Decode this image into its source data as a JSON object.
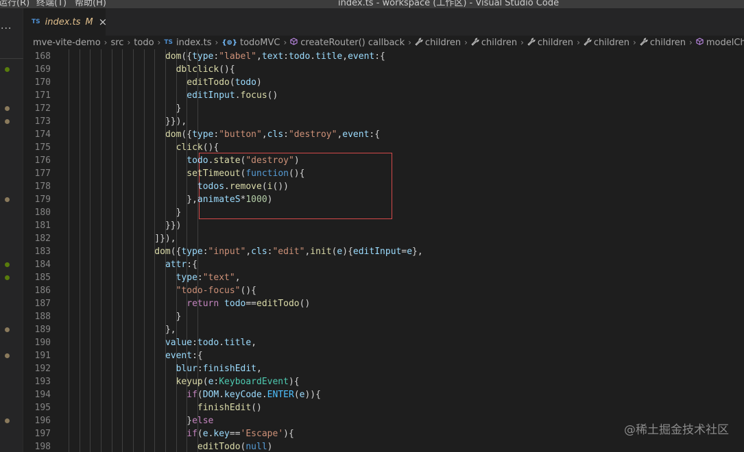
{
  "titlebar": {
    "menus": [
      "运行(R)",
      "终端(T)",
      "帮助(H)"
    ],
    "window_title": "index.ts - workspace (工作区) - Visual Studio Code"
  },
  "sidebar": {
    "more_label": "···"
  },
  "tab": {
    "lang": "TS",
    "name": "index.ts",
    "modified": "M",
    "close": "×"
  },
  "breadcrumb": {
    "items": [
      {
        "label": "mve-vite-demo",
        "icon": "none"
      },
      {
        "label": "src",
        "icon": "none"
      },
      {
        "label": "todo",
        "icon": "none"
      },
      {
        "label": "index.ts",
        "icon": "ts-file-icon",
        "badge": "TS"
      },
      {
        "label": "todoMVC",
        "icon": "namespace-icon",
        "badge": "{⊚}"
      },
      {
        "label": "createRouter() callback",
        "icon": "method-cube-icon"
      },
      {
        "label": "children",
        "icon": "wrench-icon"
      },
      {
        "label": "children",
        "icon": "wrench-icon"
      },
      {
        "label": "children",
        "icon": "wrench-icon"
      },
      {
        "label": "children",
        "icon": "wrench-icon"
      },
      {
        "label": "children",
        "icon": "wrench-icon"
      },
      {
        "label": "modelChildren()",
        "icon": "method-cube-icon"
      }
    ],
    "separator": "›"
  },
  "editor": {
    "lines": [
      {
        "n": "168",
        "indent": 18,
        "tokens": [
          [
            "dom",
            "fn"
          ],
          [
            "({",
            "punc"
          ],
          [
            "type",
            "var"
          ],
          [
            ":",
            "punc"
          ],
          [
            "\"label\"",
            "str"
          ],
          [
            ",",
            "punc"
          ],
          [
            "text",
            "var"
          ],
          [
            ":",
            "punc"
          ],
          [
            "todo",
            "var"
          ],
          [
            ".",
            "punc"
          ],
          [
            "title",
            "var"
          ],
          [
            ",",
            "punc"
          ],
          [
            "event",
            "var"
          ],
          [
            ":{",
            "punc"
          ]
        ]
      },
      {
        "n": "169",
        "indent": 20,
        "tokens": [
          [
            "dblclick",
            "fn"
          ],
          [
            "(){",
            "punc"
          ]
        ]
      },
      {
        "n": "170",
        "indent": 22,
        "tokens": [
          [
            "editTodo",
            "fn"
          ],
          [
            "(",
            "punc"
          ],
          [
            "todo",
            "var"
          ],
          [
            ")",
            "punc"
          ]
        ]
      },
      {
        "n": "171",
        "indent": 22,
        "tokens": [
          [
            "editInput",
            "var"
          ],
          [
            ".",
            "punc"
          ],
          [
            "focus",
            "fn"
          ],
          [
            "()",
            "punc"
          ]
        ]
      },
      {
        "n": "172",
        "indent": 20,
        "tokens": [
          [
            "}",
            "punc"
          ]
        ]
      },
      {
        "n": "173",
        "indent": 18,
        "tokens": [
          [
            "}}),",
            "punc"
          ]
        ]
      },
      {
        "n": "174",
        "indent": 18,
        "tokens": [
          [
            "dom",
            "fn"
          ],
          [
            "({",
            "punc"
          ],
          [
            "type",
            "var"
          ],
          [
            ":",
            "punc"
          ],
          [
            "\"button\"",
            "str"
          ],
          [
            ",",
            "punc"
          ],
          [
            "cls",
            "var"
          ],
          [
            ":",
            "punc"
          ],
          [
            "\"destroy\"",
            "str"
          ],
          [
            ",",
            "punc"
          ],
          [
            "event",
            "var"
          ],
          [
            ":{",
            "punc"
          ]
        ]
      },
      {
        "n": "175",
        "indent": 20,
        "tokens": [
          [
            "click",
            "fn"
          ],
          [
            "(){",
            "punc"
          ]
        ]
      },
      {
        "n": "176",
        "indent": 22,
        "tokens": [
          [
            "todo",
            "var"
          ],
          [
            ".",
            "punc"
          ],
          [
            "state",
            "fn"
          ],
          [
            "(",
            "punc"
          ],
          [
            "\"destroy\"",
            "str"
          ],
          [
            ")",
            "punc"
          ]
        ]
      },
      {
        "n": "177",
        "indent": 22,
        "tokens": [
          [
            "setTimeout",
            "fn"
          ],
          [
            "(",
            "punc"
          ],
          [
            "function",
            "kw"
          ],
          [
            "(){",
            "punc"
          ]
        ]
      },
      {
        "n": "178",
        "indent": 24,
        "tokens": [
          [
            "todos",
            "var"
          ],
          [
            ".",
            "punc"
          ],
          [
            "remove",
            "fn"
          ],
          [
            "(",
            "punc"
          ],
          [
            "i",
            "fn"
          ],
          [
            "())",
            "punc"
          ]
        ]
      },
      {
        "n": "179",
        "indent": 22,
        "tokens": [
          [
            "},",
            "punc"
          ],
          [
            "animateS",
            "var"
          ],
          [
            "*",
            "punc"
          ],
          [
            "1000",
            "num"
          ],
          [
            ")",
            "punc"
          ]
        ]
      },
      {
        "n": "180",
        "indent": 20,
        "tokens": [
          [
            "}",
            "punc"
          ]
        ]
      },
      {
        "n": "181",
        "indent": 18,
        "tokens": [
          [
            "}})",
            "punc"
          ]
        ]
      },
      {
        "n": "182",
        "indent": 16,
        "tokens": [
          [
            "]}),",
            "punc"
          ]
        ]
      },
      {
        "n": "183",
        "indent": 16,
        "tokens": [
          [
            "dom",
            "fn"
          ],
          [
            "({",
            "punc"
          ],
          [
            "type",
            "var"
          ],
          [
            ":",
            "punc"
          ],
          [
            "\"input\"",
            "str"
          ],
          [
            ",",
            "punc"
          ],
          [
            "cls",
            "var"
          ],
          [
            ":",
            "punc"
          ],
          [
            "\"edit\"",
            "str"
          ],
          [
            ",",
            "punc"
          ],
          [
            "init",
            "fn"
          ],
          [
            "(",
            "punc"
          ],
          [
            "e",
            "var"
          ],
          [
            "){",
            "punc"
          ],
          [
            "editInput",
            "var"
          ],
          [
            "=",
            "punc"
          ],
          [
            "e",
            "var"
          ],
          [
            "},",
            "punc"
          ]
        ]
      },
      {
        "n": "184",
        "indent": 18,
        "tokens": [
          [
            "attr",
            "var"
          ],
          [
            ":{",
            "punc"
          ]
        ]
      },
      {
        "n": "185",
        "indent": 20,
        "tokens": [
          [
            "type",
            "var"
          ],
          [
            ":",
            "punc"
          ],
          [
            "\"text\"",
            "str"
          ],
          [
            ",",
            "punc"
          ]
        ]
      },
      {
        "n": "186",
        "indent": 20,
        "tokens": [
          [
            "\"todo-focus\"",
            "str"
          ],
          [
            "(){",
            "punc"
          ]
        ]
      },
      {
        "n": "187",
        "indent": 22,
        "tokens": [
          [
            "return",
            "kw2"
          ],
          [
            " ",
            "punc"
          ],
          [
            "todo",
            "var"
          ],
          [
            "==",
            "punc"
          ],
          [
            "editTodo",
            "fn"
          ],
          [
            "()",
            "punc"
          ]
        ]
      },
      {
        "n": "188",
        "indent": 20,
        "tokens": [
          [
            "}",
            "punc"
          ]
        ]
      },
      {
        "n": "189",
        "indent": 18,
        "tokens": [
          [
            "},",
            "punc"
          ]
        ]
      },
      {
        "n": "190",
        "indent": 18,
        "tokens": [
          [
            "value",
            "var"
          ],
          [
            ":",
            "punc"
          ],
          [
            "todo",
            "var"
          ],
          [
            ".",
            "punc"
          ],
          [
            "title",
            "var"
          ],
          [
            ",",
            "punc"
          ]
        ]
      },
      {
        "n": "191",
        "indent": 18,
        "tokens": [
          [
            "event",
            "var"
          ],
          [
            ":{",
            "punc"
          ]
        ]
      },
      {
        "n": "192",
        "indent": 20,
        "tokens": [
          [
            "blur",
            "var"
          ],
          [
            ":",
            "punc"
          ],
          [
            "finishEdit",
            "var"
          ],
          [
            ",",
            "punc"
          ]
        ]
      },
      {
        "n": "193",
        "indent": 20,
        "tokens": [
          [
            "keyup",
            "fn"
          ],
          [
            "(",
            "punc"
          ],
          [
            "e",
            "var"
          ],
          [
            ":",
            "punc"
          ],
          [
            "KeyboardEvent",
            "type"
          ],
          [
            "){",
            "punc"
          ]
        ]
      },
      {
        "n": "194",
        "indent": 22,
        "tokens": [
          [
            "if",
            "kw2"
          ],
          [
            "(",
            "punc"
          ],
          [
            "DOM",
            "var"
          ],
          [
            ".",
            "punc"
          ],
          [
            "keyCode",
            "var"
          ],
          [
            ".",
            "punc"
          ],
          [
            "ENTER",
            "enum"
          ],
          [
            "(",
            "punc"
          ],
          [
            "e",
            "var"
          ],
          [
            ")){",
            "punc"
          ]
        ]
      },
      {
        "n": "195",
        "indent": 24,
        "tokens": [
          [
            "finishEdit",
            "fn"
          ],
          [
            "()",
            "punc"
          ]
        ]
      },
      {
        "n": "196",
        "indent": 22,
        "tokens": [
          [
            "}",
            "punc"
          ],
          [
            "else",
            "kw2"
          ]
        ]
      },
      {
        "n": "197",
        "indent": 22,
        "tokens": [
          [
            "if",
            "kw2"
          ],
          [
            "(",
            "punc"
          ],
          [
            "e",
            "var"
          ],
          [
            ".",
            "punc"
          ],
          [
            "key",
            "var"
          ],
          [
            "==",
            "punc"
          ],
          [
            "'Escape'",
            "str"
          ],
          [
            "){",
            "punc"
          ]
        ]
      },
      {
        "n": "198",
        "indent": 24,
        "tokens": [
          [
            "editTodo",
            "fn"
          ],
          [
            "(",
            "punc"
          ],
          [
            "null",
            "kw"
          ],
          [
            ")",
            "punc"
          ]
        ]
      }
    ],
    "gutter_dots": [
      {
        "line": "169",
        "color": "#587c0c",
        "kind": "added"
      },
      {
        "line": "172",
        "color": "#8a7a5c",
        "kind": "modified"
      },
      {
        "line": "173",
        "color": "#8a7a5c",
        "kind": "modified"
      },
      {
        "line": "179",
        "color": "#8a7a5c",
        "kind": "modified"
      },
      {
        "line": "184",
        "color": "#587c0c",
        "kind": "added"
      },
      {
        "line": "185",
        "color": "#587c0c",
        "kind": "added"
      },
      {
        "line": "189",
        "color": "#8a7a5c",
        "kind": "modified"
      },
      {
        "line": "191",
        "color": "#8a7a5c",
        "kind": "modified"
      },
      {
        "line": "196",
        "color": "#8a7a5c",
        "kind": "modified"
      }
    ]
  },
  "watermark": "@稀土掘金技术社区"
}
